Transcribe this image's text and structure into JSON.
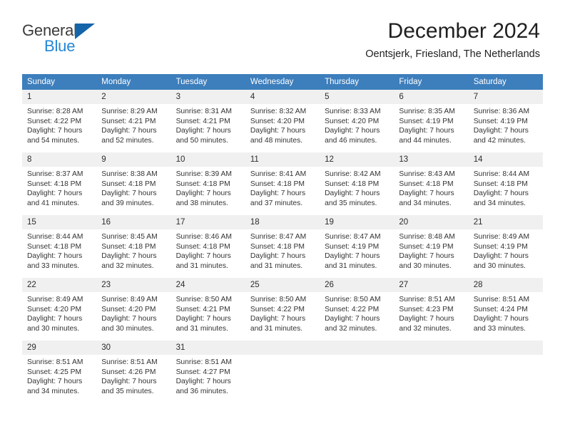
{
  "brand": {
    "name_top": "General",
    "name_bottom": "Blue",
    "accent_blue": "#2387d6",
    "triangle_blue": "#1464aa"
  },
  "header": {
    "title": "December 2024",
    "subtitle": "Oentsjerk, Friesland, The Netherlands"
  },
  "theme": {
    "header_band": "#3d7ebc",
    "daynum_band": "#f0f0f0",
    "text": "#333333"
  },
  "weekdays": [
    "Sunday",
    "Monday",
    "Tuesday",
    "Wednesday",
    "Thursday",
    "Friday",
    "Saturday"
  ],
  "weeks": [
    [
      {
        "day": "1",
        "sunrise": "Sunrise: 8:28 AM",
        "sunset": "Sunset: 4:22 PM",
        "daylight_1": "Daylight: 7 hours",
        "daylight_2": "and 54 minutes."
      },
      {
        "day": "2",
        "sunrise": "Sunrise: 8:29 AM",
        "sunset": "Sunset: 4:21 PM",
        "daylight_1": "Daylight: 7 hours",
        "daylight_2": "and 52 minutes."
      },
      {
        "day": "3",
        "sunrise": "Sunrise: 8:31 AM",
        "sunset": "Sunset: 4:21 PM",
        "daylight_1": "Daylight: 7 hours",
        "daylight_2": "and 50 minutes."
      },
      {
        "day": "4",
        "sunrise": "Sunrise: 8:32 AM",
        "sunset": "Sunset: 4:20 PM",
        "daylight_1": "Daylight: 7 hours",
        "daylight_2": "and 48 minutes."
      },
      {
        "day": "5",
        "sunrise": "Sunrise: 8:33 AM",
        "sunset": "Sunset: 4:20 PM",
        "daylight_1": "Daylight: 7 hours",
        "daylight_2": "and 46 minutes."
      },
      {
        "day": "6",
        "sunrise": "Sunrise: 8:35 AM",
        "sunset": "Sunset: 4:19 PM",
        "daylight_1": "Daylight: 7 hours",
        "daylight_2": "and 44 minutes."
      },
      {
        "day": "7",
        "sunrise": "Sunrise: 8:36 AM",
        "sunset": "Sunset: 4:19 PM",
        "daylight_1": "Daylight: 7 hours",
        "daylight_2": "and 42 minutes."
      }
    ],
    [
      {
        "day": "8",
        "sunrise": "Sunrise: 8:37 AM",
        "sunset": "Sunset: 4:18 PM",
        "daylight_1": "Daylight: 7 hours",
        "daylight_2": "and 41 minutes."
      },
      {
        "day": "9",
        "sunrise": "Sunrise: 8:38 AM",
        "sunset": "Sunset: 4:18 PM",
        "daylight_1": "Daylight: 7 hours",
        "daylight_2": "and 39 minutes."
      },
      {
        "day": "10",
        "sunrise": "Sunrise: 8:39 AM",
        "sunset": "Sunset: 4:18 PM",
        "daylight_1": "Daylight: 7 hours",
        "daylight_2": "and 38 minutes."
      },
      {
        "day": "11",
        "sunrise": "Sunrise: 8:41 AM",
        "sunset": "Sunset: 4:18 PM",
        "daylight_1": "Daylight: 7 hours",
        "daylight_2": "and 37 minutes."
      },
      {
        "day": "12",
        "sunrise": "Sunrise: 8:42 AM",
        "sunset": "Sunset: 4:18 PM",
        "daylight_1": "Daylight: 7 hours",
        "daylight_2": "and 35 minutes."
      },
      {
        "day": "13",
        "sunrise": "Sunrise: 8:43 AM",
        "sunset": "Sunset: 4:18 PM",
        "daylight_1": "Daylight: 7 hours",
        "daylight_2": "and 34 minutes."
      },
      {
        "day": "14",
        "sunrise": "Sunrise: 8:44 AM",
        "sunset": "Sunset: 4:18 PM",
        "daylight_1": "Daylight: 7 hours",
        "daylight_2": "and 34 minutes."
      }
    ],
    [
      {
        "day": "15",
        "sunrise": "Sunrise: 8:44 AM",
        "sunset": "Sunset: 4:18 PM",
        "daylight_1": "Daylight: 7 hours",
        "daylight_2": "and 33 minutes."
      },
      {
        "day": "16",
        "sunrise": "Sunrise: 8:45 AM",
        "sunset": "Sunset: 4:18 PM",
        "daylight_1": "Daylight: 7 hours",
        "daylight_2": "and 32 minutes."
      },
      {
        "day": "17",
        "sunrise": "Sunrise: 8:46 AM",
        "sunset": "Sunset: 4:18 PM",
        "daylight_1": "Daylight: 7 hours",
        "daylight_2": "and 31 minutes."
      },
      {
        "day": "18",
        "sunrise": "Sunrise: 8:47 AM",
        "sunset": "Sunset: 4:18 PM",
        "daylight_1": "Daylight: 7 hours",
        "daylight_2": "and 31 minutes."
      },
      {
        "day": "19",
        "sunrise": "Sunrise: 8:47 AM",
        "sunset": "Sunset: 4:19 PM",
        "daylight_1": "Daylight: 7 hours",
        "daylight_2": "and 31 minutes."
      },
      {
        "day": "20",
        "sunrise": "Sunrise: 8:48 AM",
        "sunset": "Sunset: 4:19 PM",
        "daylight_1": "Daylight: 7 hours",
        "daylight_2": "and 30 minutes."
      },
      {
        "day": "21",
        "sunrise": "Sunrise: 8:49 AM",
        "sunset": "Sunset: 4:19 PM",
        "daylight_1": "Daylight: 7 hours",
        "daylight_2": "and 30 minutes."
      }
    ],
    [
      {
        "day": "22",
        "sunrise": "Sunrise: 8:49 AM",
        "sunset": "Sunset: 4:20 PM",
        "daylight_1": "Daylight: 7 hours",
        "daylight_2": "and 30 minutes."
      },
      {
        "day": "23",
        "sunrise": "Sunrise: 8:49 AM",
        "sunset": "Sunset: 4:20 PM",
        "daylight_1": "Daylight: 7 hours",
        "daylight_2": "and 30 minutes."
      },
      {
        "day": "24",
        "sunrise": "Sunrise: 8:50 AM",
        "sunset": "Sunset: 4:21 PM",
        "daylight_1": "Daylight: 7 hours",
        "daylight_2": "and 31 minutes."
      },
      {
        "day": "25",
        "sunrise": "Sunrise: 8:50 AM",
        "sunset": "Sunset: 4:22 PM",
        "daylight_1": "Daylight: 7 hours",
        "daylight_2": "and 31 minutes."
      },
      {
        "day": "26",
        "sunrise": "Sunrise: 8:50 AM",
        "sunset": "Sunset: 4:22 PM",
        "daylight_1": "Daylight: 7 hours",
        "daylight_2": "and 32 minutes."
      },
      {
        "day": "27",
        "sunrise": "Sunrise: 8:51 AM",
        "sunset": "Sunset: 4:23 PM",
        "daylight_1": "Daylight: 7 hours",
        "daylight_2": "and 32 minutes."
      },
      {
        "day": "28",
        "sunrise": "Sunrise: 8:51 AM",
        "sunset": "Sunset: 4:24 PM",
        "daylight_1": "Daylight: 7 hours",
        "daylight_2": "and 33 minutes."
      }
    ],
    [
      {
        "day": "29",
        "sunrise": "Sunrise: 8:51 AM",
        "sunset": "Sunset: 4:25 PM",
        "daylight_1": "Daylight: 7 hours",
        "daylight_2": "and 34 minutes."
      },
      {
        "day": "30",
        "sunrise": "Sunrise: 8:51 AM",
        "sunset": "Sunset: 4:26 PM",
        "daylight_1": "Daylight: 7 hours",
        "daylight_2": "and 35 minutes."
      },
      {
        "day": "31",
        "sunrise": "Sunrise: 8:51 AM",
        "sunset": "Sunset: 4:27 PM",
        "daylight_1": "Daylight: 7 hours",
        "daylight_2": "and 36 minutes."
      },
      {
        "day": "",
        "sunrise": "",
        "sunset": "",
        "daylight_1": "",
        "daylight_2": ""
      },
      {
        "day": "",
        "sunrise": "",
        "sunset": "",
        "daylight_1": "",
        "daylight_2": ""
      },
      {
        "day": "",
        "sunrise": "",
        "sunset": "",
        "daylight_1": "",
        "daylight_2": ""
      },
      {
        "day": "",
        "sunrise": "",
        "sunset": "",
        "daylight_1": "",
        "daylight_2": ""
      }
    ]
  ]
}
